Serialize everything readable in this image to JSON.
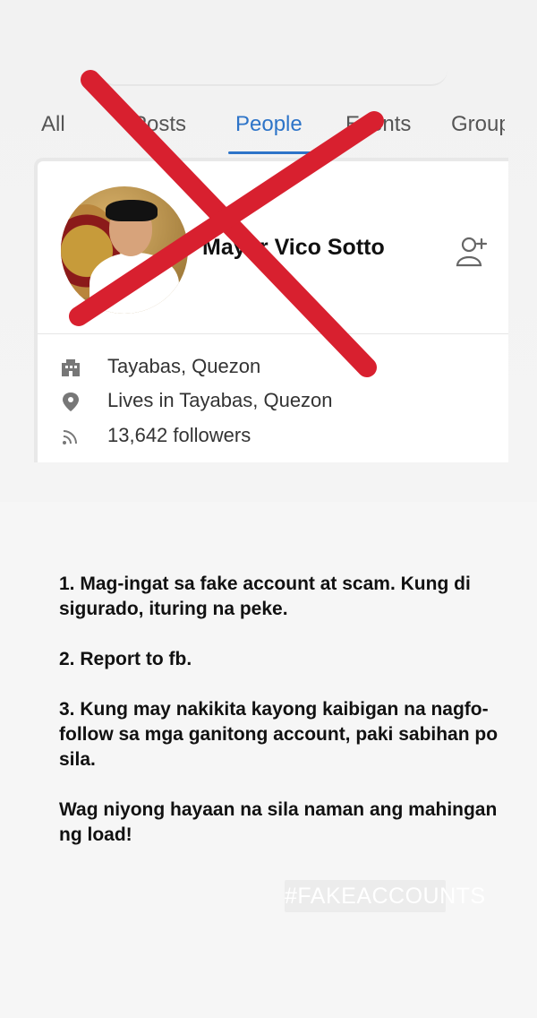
{
  "tabs": [
    {
      "label": "All",
      "active": false
    },
    {
      "label": "Posts",
      "active": false
    },
    {
      "label": "People",
      "active": true
    },
    {
      "label": "Events",
      "active": false
    },
    {
      "label": "Groups",
      "active": false
    }
  ],
  "profile": {
    "name": "Mayor Vico Sotto",
    "add_friend_icon": "add-friend-icon",
    "details": [
      {
        "icon": "building-icon",
        "text": "Tayabas, Quezon"
      },
      {
        "icon": "location-pin-icon",
        "text": "Lives in Tayabas, Quezon"
      },
      {
        "icon": "followers-icon",
        "text": "13,642 followers"
      }
    ]
  },
  "annotation": {
    "type": "red-x",
    "color": "#d8202f"
  },
  "message": [
    "1. Mag-ingat sa fake account at scam. Kung di sigurado, ituring na peke.",
    "2. Report to fb.",
    "3. Kung may nakikita kayong kaibigan na nagfo-follow sa mga ganitong account, paki sabihan po sila.",
    "Wag niyong hayaan na sila naman ang mahingan ng load!"
  ],
  "hashtag": "#FAKEACCOUNTS",
  "colors": {
    "facebook_blue": "#2d74c8",
    "text": "#111111",
    "muted_text": "#555555",
    "red_mark": "#d8202f"
  }
}
